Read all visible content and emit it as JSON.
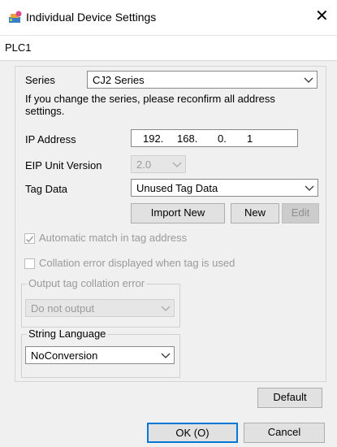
{
  "window": {
    "title": "Individual Device Settings",
    "close_icon": "close-icon",
    "app_icon": "device-settings-icon"
  },
  "device": {
    "name": "PLC1"
  },
  "series": {
    "label": "Series",
    "value": "CJ2 Series"
  },
  "notice": {
    "line1": "If you change the series, please reconfirm all address",
    "line2": "settings."
  },
  "ip": {
    "label": "IP Address",
    "oct1": "192.",
    "oct2": "168.",
    "oct3": "0.",
    "oct4": "1"
  },
  "eip": {
    "label": "EIP Unit Version",
    "value": "2.0"
  },
  "tag_data": {
    "label": "Tag Data",
    "value": "Unused Tag Data"
  },
  "buttons": {
    "import_new": "Import New",
    "new": "New",
    "edit": "Edit",
    "default": "Default",
    "ok": "OK (O)",
    "cancel": "Cancel"
  },
  "auto_match": {
    "label": "Automatic match in tag address",
    "checked": true
  },
  "collation": {
    "label": "Collation error displayed when tag is used",
    "checked": false
  },
  "output_tag": {
    "legend": "Output tag collation error",
    "value": "Do not output"
  },
  "string_lang": {
    "legend": "String Language",
    "value": "NoConversion"
  }
}
